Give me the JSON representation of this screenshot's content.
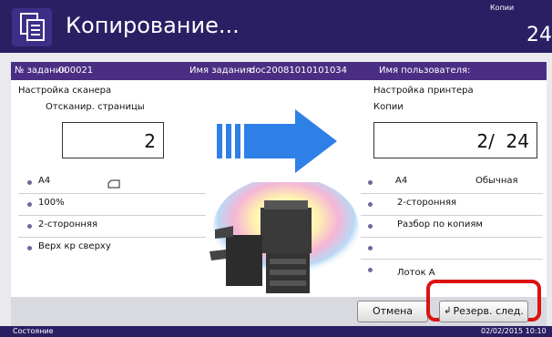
{
  "header": {
    "title": "Копирование...",
    "copies_label": "Копии",
    "copies_value": "24",
    "icon": "copy-document-icon"
  },
  "job": {
    "number_label": "№ задания",
    "number_value": "000021",
    "name_label": "Имя задания:",
    "name_value": "doc20081010101034",
    "user_label": "Имя пользователя:"
  },
  "scanner": {
    "section_label": "Настройка сканера",
    "pages_label": "Отсканир. страницы",
    "pages_value": "2",
    "rows": [
      "A4",
      "100%",
      "2-сторонняя",
      "Верх кр сверху"
    ],
    "orientation_icon": "paper-orientation-icon"
  },
  "printer": {
    "section_label": "Настройка принтера",
    "copies_label": "Копии",
    "copies_value": "2/  24",
    "rows": [
      {
        "left": "A4",
        "right": "Обычная"
      },
      {
        "left": "2-сторонняя",
        "right": ""
      },
      {
        "left": "Разбор по копиям",
        "right": ""
      },
      {
        "left": "",
        "right": ""
      },
      {
        "left": "Лоток A",
        "right": ""
      }
    ]
  },
  "buttons": {
    "cancel": "Отмена",
    "reserve_next": "Резерв. след."
  },
  "status": {
    "label": "Состояние",
    "datetime": "02/02/2015  10:10"
  },
  "colors": {
    "header_bg": "#2a1f63",
    "jobbar_bg": "#4a2e83",
    "arrow": "#2f80e6",
    "highlight": "#dd1111"
  }
}
